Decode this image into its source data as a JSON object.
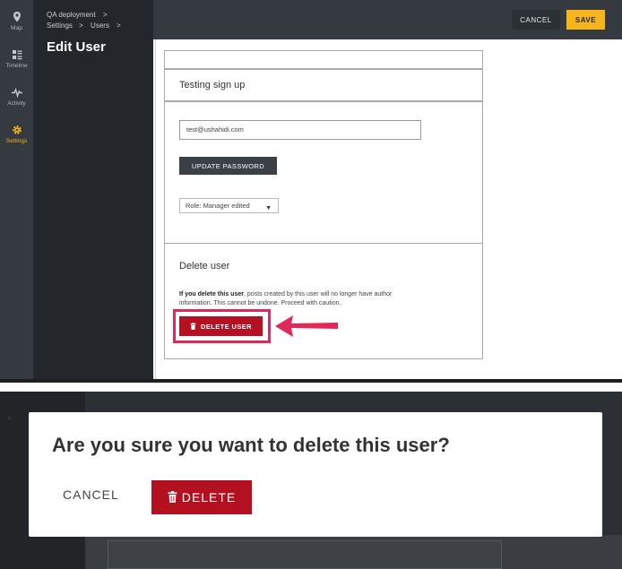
{
  "rail": {
    "items": [
      {
        "label": "Map",
        "icon": "map-pin-icon"
      },
      {
        "label": "Timeline",
        "icon": "timeline-icon"
      },
      {
        "label": "Activity",
        "icon": "activity-icon"
      },
      {
        "label": "Settings",
        "icon": "gear-icon",
        "active": true
      }
    ]
  },
  "sidebar": {
    "breadcrumb": [
      "QA deployment",
      "Settings",
      "Users"
    ],
    "separator": ">",
    "title": "Edit User"
  },
  "toolbar": {
    "cancel_label": "CANCEL",
    "save_label": "SAVE"
  },
  "form": {
    "username": "Testing sign up",
    "email_value": "test@ushahidi.com",
    "update_password_label": "UPDATE PASSWORD",
    "role_value": "Role: Manager edited",
    "delete_section_title": "Delete user",
    "delete_warning_bold": "If you delete this user",
    "delete_warning_rest": ", posts created by this user will no longer have author information. This cannot be undone. Proceed with caution.",
    "delete_user_label": "DELETE USER"
  },
  "dialog": {
    "question": "Are you sure you want to delete this user?",
    "cancel_label": "CANCEL",
    "delete_label": "DELETE"
  },
  "colors": {
    "accent": "#f6b519",
    "danger": "#b41224",
    "highlight": "#e0285a",
    "rail": "#343a40",
    "sidebar": "#23272b"
  }
}
